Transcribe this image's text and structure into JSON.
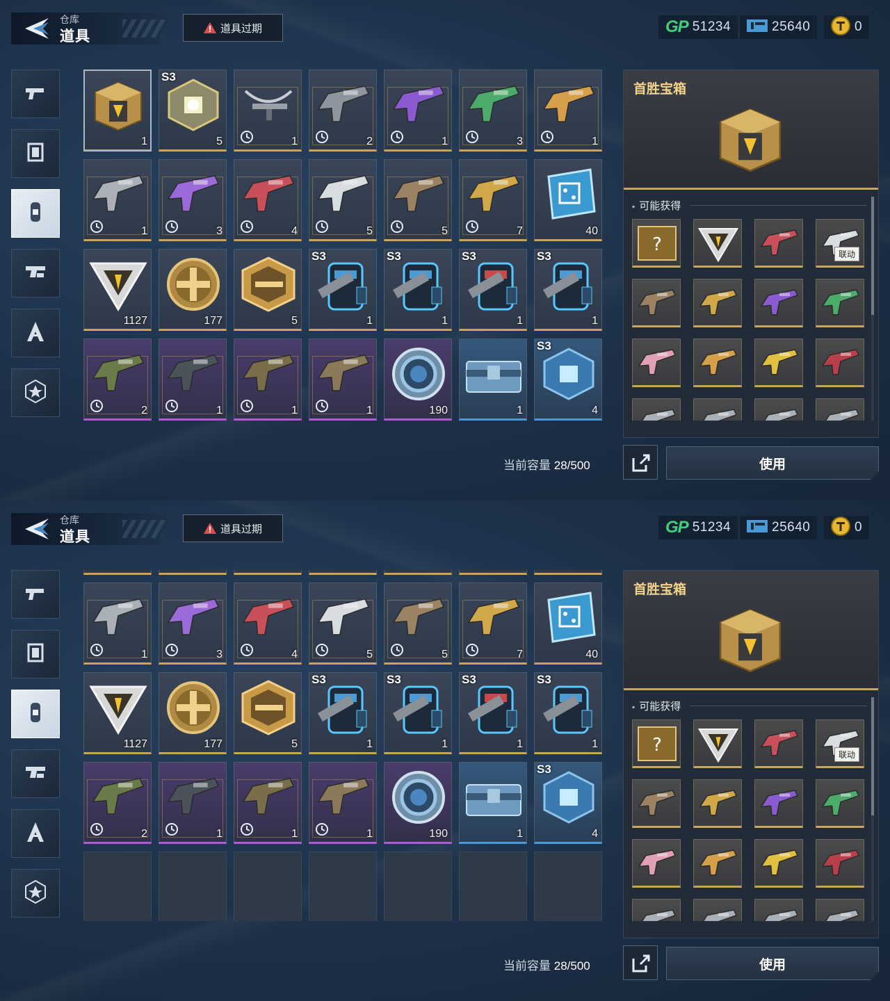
{
  "header": {
    "crumb": "仓库",
    "title": "道具",
    "expire_button": "道具过期",
    "currencies": [
      {
        "icon": "gp-icon",
        "label": "GP",
        "value": "51234"
      },
      {
        "icon": "ticket-icon",
        "value": "25640"
      },
      {
        "icon": "coin-icon",
        "value": "0"
      }
    ]
  },
  "sidebar": [
    {
      "icon": "pistol-icon",
      "active": false
    },
    {
      "icon": "frame-icon",
      "active": false
    },
    {
      "icon": "consumable-icon",
      "active": true
    },
    {
      "icon": "gun-parts-icon",
      "active": false
    },
    {
      "icon": "tools-icon",
      "active": false
    },
    {
      "icon": "star-badge-icon",
      "active": false
    }
  ],
  "grid": [
    {
      "art": "golden-chest",
      "count": "1",
      "rarity": "gold",
      "selected": true
    },
    {
      "art": "gold-cube",
      "count": "5",
      "season": "S3",
      "rarity": "gold"
    },
    {
      "art": "crossbow",
      "count": "1",
      "rarity": "gold",
      "timed": true
    },
    {
      "art": "smg-grey",
      "count": "2",
      "rarity": "gold",
      "timed": true
    },
    {
      "art": "rifle-purple",
      "count": "1",
      "rarity": "gold",
      "timed": true
    },
    {
      "art": "rifle-green",
      "count": "3",
      "rarity": "gold",
      "timed": true
    },
    {
      "art": "rifle-gold",
      "count": "1",
      "rarity": "gold",
      "timed": true
    },
    {
      "art": "rifle-silver",
      "count": "1",
      "rarity": "gold",
      "timed": true
    },
    {
      "art": "sword-purple",
      "count": "3",
      "rarity": "gold",
      "timed": true
    },
    {
      "art": "rifle-red",
      "count": "4",
      "rarity": "gold",
      "timed": true
    },
    {
      "art": "rifle-white",
      "count": "5",
      "rarity": "gold",
      "timed": true
    },
    {
      "art": "rifle-brown",
      "count": "5",
      "rarity": "gold",
      "timed": true
    },
    {
      "art": "rifle-color",
      "count": "7",
      "rarity": "gold",
      "timed": true
    },
    {
      "art": "chip-card",
      "count": "40",
      "rarity": "gold"
    },
    {
      "art": "triangle-token",
      "count": "1127",
      "rarity": "gold"
    },
    {
      "art": "cross-coin",
      "count": "177",
      "rarity": "gold"
    },
    {
      "art": "hex-badge",
      "count": "5",
      "rarity": "gold"
    },
    {
      "art": "backpack-blue",
      "count": "1",
      "season": "S3",
      "rarity": "gold"
    },
    {
      "art": "backpack-blue",
      "count": "1",
      "season": "S3",
      "rarity": "gold"
    },
    {
      "art": "backpack-red",
      "count": "1",
      "season": "S3",
      "rarity": "gold"
    },
    {
      "art": "backpack-blue",
      "count": "1",
      "season": "S3",
      "rarity": "gold"
    },
    {
      "art": "rifle-camo",
      "count": "2",
      "rarity": "purple",
      "timed": true
    },
    {
      "art": "rifle-dark",
      "count": "1",
      "rarity": "purple",
      "timed": true
    },
    {
      "art": "rifle-olive",
      "count": "1",
      "rarity": "purple",
      "timed": true
    },
    {
      "art": "rifle-tan",
      "count": "1",
      "rarity": "purple",
      "timed": true
    },
    {
      "art": "blue-disc",
      "count": "190",
      "rarity": "purple"
    },
    {
      "art": "blue-case",
      "count": "1",
      "rarity": "blue"
    },
    {
      "art": "blue-cube",
      "count": "4",
      "season": "S3",
      "rarity": "blue"
    }
  ],
  "capacity": {
    "label": "当前容量",
    "used": "28",
    "total": "/500"
  },
  "panel": {
    "title": "首胜宝箱",
    "sub_title": "可能获得",
    "pool": [
      {
        "art": "mystery-card"
      },
      {
        "art": "triangle-token"
      },
      {
        "art": "rifle-red"
      },
      {
        "art": "rifle-white",
        "tag": "联动"
      },
      {
        "art": "rifle-brown"
      },
      {
        "art": "rifle-color"
      },
      {
        "art": "rifle-purple"
      },
      {
        "art": "rifle-green"
      },
      {
        "art": "rifle-pink"
      },
      {
        "art": "rifle-gold"
      },
      {
        "art": "rifle-yellow"
      },
      {
        "art": "rifle-crimson"
      },
      {
        "art": "rifle-silver"
      },
      {
        "art": "rifle-silver"
      },
      {
        "art": "rifle-silver"
      },
      {
        "art": "rifle-silver"
      }
    ]
  },
  "use_button": "使用",
  "colors": {
    "gold": "#c8a55a",
    "purple": "#b25ad6",
    "blue": "#4a9ad6",
    "gp": "#3fd07a"
  }
}
